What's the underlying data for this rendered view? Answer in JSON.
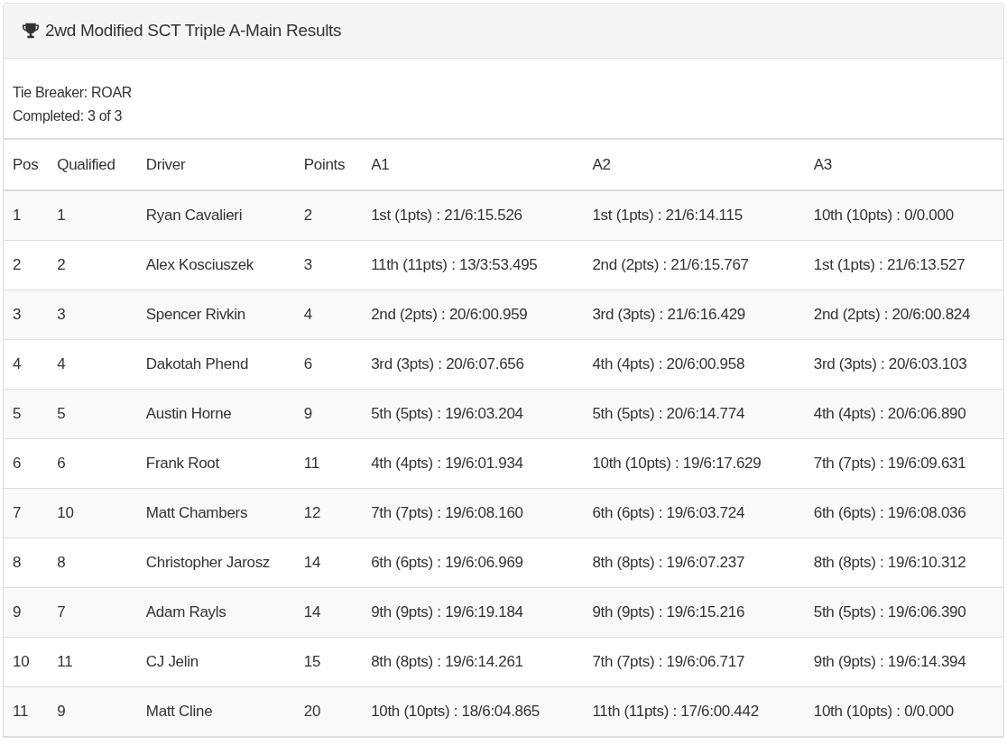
{
  "panel": {
    "title": "2wd Modified SCT Triple A-Main Results"
  },
  "info": [
    "Tie Breaker: ROAR",
    "Completed: 3 of 3"
  ],
  "table": {
    "columns": [
      "Pos",
      "Qualified",
      "Driver",
      "Points",
      "A1",
      "A2",
      "A3"
    ],
    "rows": [
      [
        "1",
        "1",
        "Ryan Cavalieri",
        "2",
        "1st (1pts) : 21/6:15.526",
        "1st (1pts) : 21/6:14.115",
        "10th (10pts) : 0/0.000"
      ],
      [
        "2",
        "2",
        "Alex Kosciuszek",
        "3",
        "11th (11pts) : 13/3:53.495",
        "2nd (2pts) : 21/6:15.767",
        "1st (1pts) : 21/6:13.527"
      ],
      [
        "3",
        "3",
        "Spencer Rivkin",
        "4",
        "2nd (2pts) : 20/6:00.959",
        "3rd (3pts) : 21/6:16.429",
        "2nd (2pts) : 20/6:00.824"
      ],
      [
        "4",
        "4",
        "Dakotah Phend",
        "6",
        "3rd (3pts) : 20/6:07.656",
        "4th (4pts) : 20/6:00.958",
        "3rd (3pts) : 20/6:03.103"
      ],
      [
        "5",
        "5",
        "Austin Horne",
        "9",
        "5th (5pts) : 19/6:03.204",
        "5th (5pts) : 20/6:14.774",
        "4th (4pts) : 20/6:06.890"
      ],
      [
        "6",
        "6",
        "Frank Root",
        "11",
        "4th (4pts) : 19/6:01.934",
        "10th (10pts) : 19/6:17.629",
        "7th (7pts) : 19/6:09.631"
      ],
      [
        "7",
        "10",
        "Matt Chambers",
        "12",
        "7th (7pts) : 19/6:08.160",
        "6th (6pts) : 19/6:03.724",
        "6th (6pts) : 19/6:08.036"
      ],
      [
        "8",
        "8",
        "Christopher Jarosz",
        "14",
        "6th (6pts) : 19/6:06.969",
        "8th (8pts) : 19/6:07.237",
        "8th (8pts) : 19/6:10.312"
      ],
      [
        "9",
        "7",
        "Adam Rayls",
        "14",
        "9th (9pts) : 19/6:19.184",
        "9th (9pts) : 19/6:15.216",
        "5th (5pts) : 19/6:06.390"
      ],
      [
        "10",
        "11",
        "CJ Jelin",
        "15",
        "8th (8pts) : 19/6:14.261",
        "7th (7pts) : 19/6:06.717",
        "9th (9pts) : 19/6:14.394"
      ],
      [
        "11",
        "9",
        "Matt Cline",
        "20",
        "10th (10pts) : 18/6:04.865",
        "11th (11pts) : 17/6:00.442",
        "10th (10pts) : 0/0.000"
      ]
    ]
  }
}
